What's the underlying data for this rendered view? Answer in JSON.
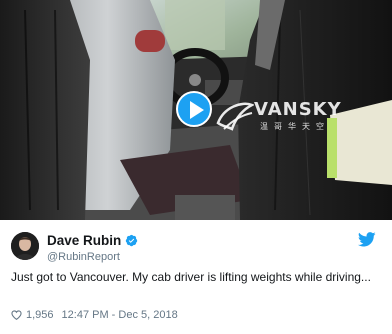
{
  "video": {
    "play_label": "Play video",
    "watermark": {
      "brand": "VANSKY",
      "sub": "温哥华天空"
    }
  },
  "tweet": {
    "author_name": "Dave Rubin",
    "author_handle": "@RubinReport",
    "verified": true,
    "text": "Just got to Vancouver. My cab driver is lifting weights while driving...",
    "like_count": "1,956",
    "timestamp": "12:47 PM - Dec 5, 2018"
  },
  "icons": {
    "play": "play-icon",
    "verified": "verified-badge-icon",
    "brand": "twitter-bird-icon",
    "like": "heart-icon"
  },
  "colors": {
    "twitter_blue": "#1da1f2",
    "secondary_text": "#657786",
    "primary_text": "#14171a"
  }
}
